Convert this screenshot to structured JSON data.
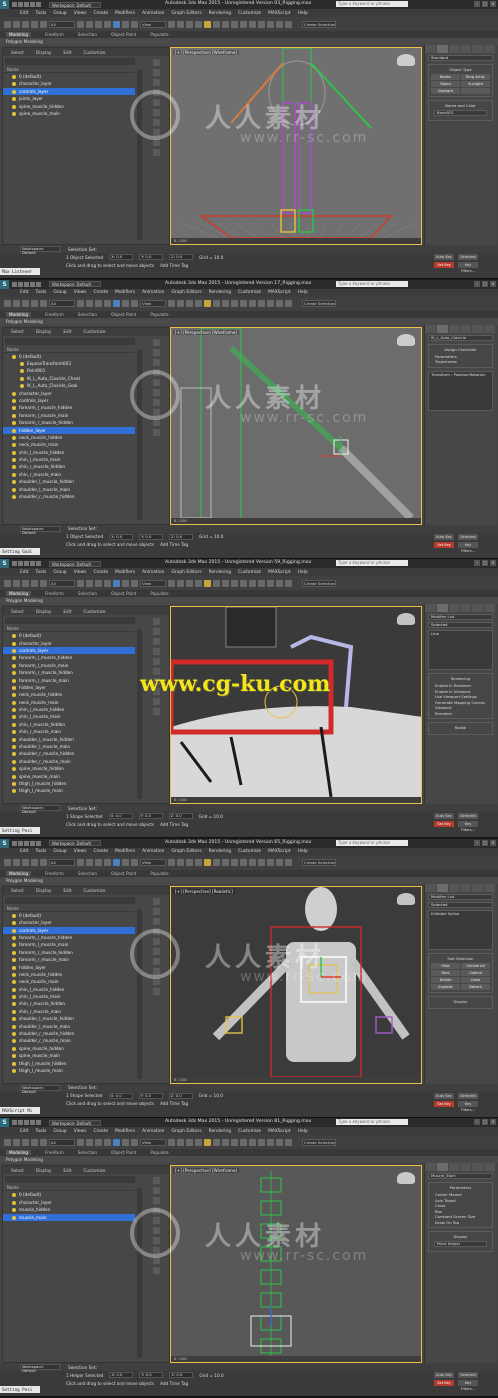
{
  "app": {
    "title": "Autodesk 3ds Max 2015 - Unregistered Version",
    "search_placeholder": "Type a keyword or phrase",
    "workspace_label": "Workspace: Default",
    "menu": [
      "Edit",
      "Tools",
      "Group",
      "Views",
      "Create",
      "Modifiers",
      "Animation",
      "Graph Editors",
      "Rendering",
      "Customize",
      "MAXScript",
      "Help"
    ],
    "ribbon_tabs": [
      "Modeling",
      "Freeform",
      "Selection",
      "Object Paint",
      "Populate"
    ],
    "ribbon_row": "Polygon Modeling",
    "explorer_menu": [
      "Select",
      "Display",
      "Edit",
      "Customize"
    ],
    "explorer_header": "Name",
    "status_hint": "Click and drag to select and move objects",
    "add_time_tag": "Add Time Tag",
    "auto_key": "Auto Key",
    "set_key": "Set Key",
    "key_filters": "Key Filters...",
    "selected_label": "Selected",
    "grid_label": "Grid = 10.0",
    "coords": [
      "X: 0.0",
      "Y: 0.0",
      "Z: 0.0"
    ]
  },
  "watermarks": {
    "cn_text": "人人素材",
    "url_text": "www.rr-sc.com",
    "cgku": "www.cg-ku.com"
  },
  "frames": [
    {
      "file": "03_Rigging.max",
      "selection_count": "1 Object Selected",
      "viewport_label": "[+] [Perspective] [Wireframe]",
      "frame_counter": "0 / 100",
      "listener": "Max Listener",
      "explorer": [
        {
          "name": "0 (default)",
          "child": false,
          "sel": false
        },
        {
          "name": "character_layer",
          "child": false,
          "sel": false
        },
        {
          "name": "controls_layer",
          "child": false,
          "sel": true
        },
        {
          "name": "joints_layer",
          "child": false,
          "sel": false
        },
        {
          "name": "spine_muscle_hidden",
          "child": false,
          "sel": false
        },
        {
          "name": "spine_muscle_main",
          "child": false,
          "sel": false
        }
      ],
      "cmd": {
        "field": "Standard",
        "group": "Object Type",
        "buttons": [
          "Bones",
          "Ring Array",
          "Biped",
          "Sunlight",
          "Daylight",
          ""
        ],
        "name_group": "Name and Color",
        "name_value": "Bone001"
      },
      "mode": "helper"
    },
    {
      "file": "17_Rigging.max",
      "selection_count": "1 Object Selected",
      "viewport_label": "[+] [Perspective] [Wireframe]",
      "frame_counter": "0 / 100",
      "listener": "Setting Goal",
      "explorer": [
        {
          "name": "0 (default)",
          "child": false,
          "sel": false
        },
        {
          "name": "ExposeTransform003",
          "child": true,
          "sel": false
        },
        {
          "name": "Point001",
          "child": true,
          "sel": false
        },
        {
          "name": "IK_L_Auto_Clavicle_Cheat",
          "child": true,
          "sel": false
        },
        {
          "name": "IK_L_Auto_Clavicle_Goal",
          "child": true,
          "sel": false
        },
        {
          "name": "character_layer",
          "child": false,
          "sel": false
        },
        {
          "name": "controls_layer",
          "child": false,
          "sel": false
        },
        {
          "name": "forearm_l_muscle_hidden",
          "child": false,
          "sel": false
        },
        {
          "name": "forearm_l_muscle_main",
          "child": false,
          "sel": false
        },
        {
          "name": "forearm_r_muscle_hidden",
          "child": false,
          "sel": false
        },
        {
          "name": "hidden_layer",
          "child": false,
          "sel": true
        },
        {
          "name": "neck_muscle_hidden",
          "child": false,
          "sel": false
        },
        {
          "name": "neck_muscle_main",
          "child": false,
          "sel": false
        },
        {
          "name": "shin_l_muscle_hidden",
          "child": false,
          "sel": false
        },
        {
          "name": "shin_l_muscle_main",
          "child": false,
          "sel": false
        },
        {
          "name": "shin_r_muscle_hidden",
          "child": false,
          "sel": false
        },
        {
          "name": "shin_r_muscle_main",
          "child": false,
          "sel": false
        },
        {
          "name": "shoulder_l_muscle_hidden",
          "child": false,
          "sel": false
        },
        {
          "name": "shoulder_l_muscle_main",
          "child": false,
          "sel": false
        },
        {
          "name": "shoulder_r_muscle_hidden",
          "child": false,
          "sel": false
        }
      ],
      "cmd": {
        "field": "IK_L_Auto_Clavicle",
        "group": "Assign Controller",
        "buttons": [
          "Parameters",
          "Trajectories"
        ],
        "name_group": "",
        "name_value": "Transform : Position/Rotation"
      },
      "mode": "ik"
    },
    {
      "file": "59_Rigging.max",
      "selection_count": "1 Shape Selected",
      "viewport_label": "",
      "frame_counter": "0 / 100",
      "listener": "Setting Posi",
      "explorer": [
        {
          "name": "0 (default)",
          "child": false,
          "sel": false
        },
        {
          "name": "character_layer",
          "child": false,
          "sel": false
        },
        {
          "name": "controls_layer",
          "child": false,
          "sel": true
        },
        {
          "name": "forearm_l_muscle_hidden",
          "child": false,
          "sel": false
        },
        {
          "name": "forearm_l_muscle_main",
          "child": false,
          "sel": false
        },
        {
          "name": "forearm_r_muscle_hidden",
          "child": false,
          "sel": false
        },
        {
          "name": "forearm_r_muscle_main",
          "child": false,
          "sel": false
        },
        {
          "name": "hidden_layer",
          "child": false,
          "sel": false
        },
        {
          "name": "neck_muscle_hidden",
          "child": false,
          "sel": false
        },
        {
          "name": "neck_muscle_main",
          "child": false,
          "sel": false
        },
        {
          "name": "shin_l_muscle_hidden",
          "child": false,
          "sel": false
        },
        {
          "name": "shin_l_muscle_main",
          "child": false,
          "sel": false
        },
        {
          "name": "shin_r_muscle_hidden",
          "child": false,
          "sel": false
        },
        {
          "name": "shin_r_muscle_main",
          "child": false,
          "sel": false
        },
        {
          "name": "shoulder_l_muscle_hidden",
          "child": false,
          "sel": false
        },
        {
          "name": "shoulder_l_muscle_main",
          "child": false,
          "sel": false
        },
        {
          "name": "shoulder_r_muscle_hidden",
          "child": false,
          "sel": false
        },
        {
          "name": "shoulder_r_muscle_main",
          "child": false,
          "sel": false
        },
        {
          "name": "spine_muscle_hidden",
          "child": false,
          "sel": false
        },
        {
          "name": "spine_muscle_main",
          "child": false,
          "sel": false
        },
        {
          "name": "thigh_l_muscle_hidden",
          "child": false,
          "sel": false
        },
        {
          "name": "thigh_l_muscle_main",
          "child": false,
          "sel": false
        }
      ],
      "cmd": {
        "field": "Modifier List",
        "group": "Rendering",
        "buttons": [
          "Enable In Renderer",
          "Enable In Viewport",
          "Use Viewport Settings",
          "Generate Mapping Coords.",
          "Viewport",
          "Renderer"
        ],
        "name_group": "Radial",
        "name_value": "Line"
      },
      "mode": "shape"
    },
    {
      "file": "65_Rigging.max",
      "selection_count": "1 Shape Selected",
      "viewport_label": "[+] [Perspective] [Realistic]",
      "frame_counter": "0 / 100",
      "listener": "MAXScript Mi",
      "explorer": [
        {
          "name": "0 (default)",
          "child": false,
          "sel": false
        },
        {
          "name": "character_layer",
          "child": false,
          "sel": false
        },
        {
          "name": "controls_layer",
          "child": false,
          "sel": true
        },
        {
          "name": "forearm_l_muscle_hidden",
          "child": false,
          "sel": false
        },
        {
          "name": "forearm_l_muscle_main",
          "child": false,
          "sel": false
        },
        {
          "name": "forearm_r_muscle_hidden",
          "child": false,
          "sel": false
        },
        {
          "name": "forearm_r_muscle_main",
          "child": false,
          "sel": false
        },
        {
          "name": "hidden_layer",
          "child": false,
          "sel": false
        },
        {
          "name": "neck_muscle_hidden",
          "child": false,
          "sel": false
        },
        {
          "name": "neck_muscle_main",
          "child": false,
          "sel": false
        },
        {
          "name": "shin_l_muscle_hidden",
          "child": false,
          "sel": false
        },
        {
          "name": "shin_l_muscle_main",
          "child": false,
          "sel": false
        },
        {
          "name": "shin_r_muscle_hidden",
          "child": false,
          "sel": false
        },
        {
          "name": "shin_r_muscle_main",
          "child": false,
          "sel": false
        },
        {
          "name": "shoulder_l_muscle_hidden",
          "child": false,
          "sel": false
        },
        {
          "name": "shoulder_l_muscle_main",
          "child": false,
          "sel": false
        },
        {
          "name": "shoulder_r_muscle_hidden",
          "child": false,
          "sel": false
        },
        {
          "name": "shoulder_r_muscle_main",
          "child": false,
          "sel": false
        },
        {
          "name": "spine_muscle_hidden",
          "child": false,
          "sel": false
        },
        {
          "name": "spine_muscle_main",
          "child": false,
          "sel": false
        },
        {
          "name": "thigh_l_muscle_hidden",
          "child": false,
          "sel": false
        },
        {
          "name": "thigh_l_muscle_main",
          "child": false,
          "sel": false
        }
      ],
      "cmd": {
        "field": "Modifier List",
        "group": "Soft Selection",
        "buttons": [
          "Hide",
          "Unhide All",
          "Bind",
          "Unbind",
          "Delete",
          "Close",
          "Explode",
          "Detach"
        ],
        "name_group": "Display",
        "name_value": "Editable Spline"
      },
      "mode": "spline"
    },
    {
      "file": "81_Rigging.max",
      "selection_count": "1 Helper Selected",
      "viewport_label": "[+] [Perspective] [Wireframe]",
      "frame_counter": "0 / 100",
      "listener": "Setting Posi",
      "explorer": [
        {
          "name": "0 (default)",
          "child": false,
          "sel": false
        },
        {
          "name": "character_layer",
          "child": false,
          "sel": false
        },
        {
          "name": "muscle_hidden",
          "child": false,
          "sel": false
        },
        {
          "name": "muscle_main",
          "child": false,
          "sel": true
        }
      ],
      "cmd": {
        "field": "Muscle_Start",
        "group": "Parameters",
        "buttons": [
          "Center Marker",
          "Axis Tripod",
          "Cross",
          "Box",
          "Constant Screen Size",
          "Draw On Top"
        ],
        "name_group": "Display",
        "name_value": "Point Helper"
      },
      "mode": "point"
    }
  ]
}
